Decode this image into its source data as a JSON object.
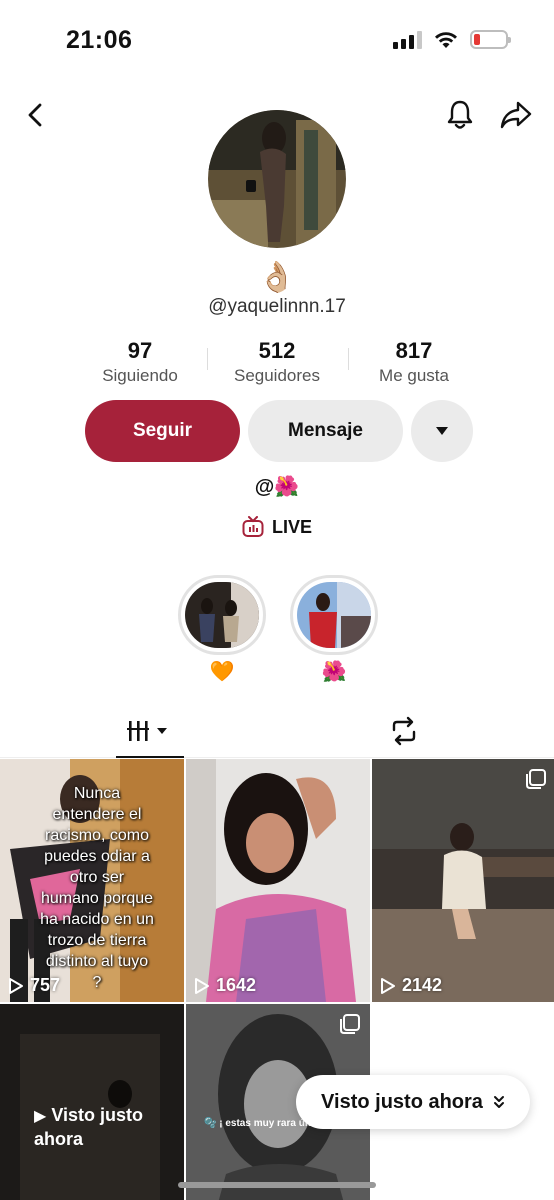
{
  "status_bar": {
    "time": "21:06",
    "battery_color": "#e53935",
    "icons": [
      "signal-icon",
      "wifi-icon",
      "battery-low-icon"
    ]
  },
  "topbar": {
    "icons": [
      "back-icon",
      "bell-icon",
      "share-icon"
    ]
  },
  "profile": {
    "display_emoji": "👌🏼",
    "username": "@yaquelinnn.17",
    "stats": [
      {
        "value": "97",
        "label": "Siguiendo"
      },
      {
        "value": "512",
        "label": "Seguidores"
      },
      {
        "value": "817",
        "label": "Me gusta"
      }
    ],
    "follow_label": "Seguir",
    "message_label": "Mensaje",
    "bio": "@🌺",
    "live_label": "LIVE",
    "accent_color": "#a6223a"
  },
  "highlights": [
    {
      "emoji": "🧡"
    },
    {
      "emoji": "🌺"
    }
  ],
  "tabs": {
    "icons": [
      "videos-grid-icon",
      "repost-icon"
    ]
  },
  "videos": [
    {
      "views": "757",
      "caption": "Nunca entendere el racismo, como puedes odiar a otro ser humano porque ha nacido en un trozo de tierra distinto al tuyo ?"
    },
    {
      "views": "1642"
    },
    {
      "views": "2142"
    },
    {
      "seen_label": "Visto justo ahora"
    },
    {
      "caption": "🫧 ¡ estas muy rara últim"
    }
  ],
  "toast": {
    "label": "Visto justo ahora"
  }
}
